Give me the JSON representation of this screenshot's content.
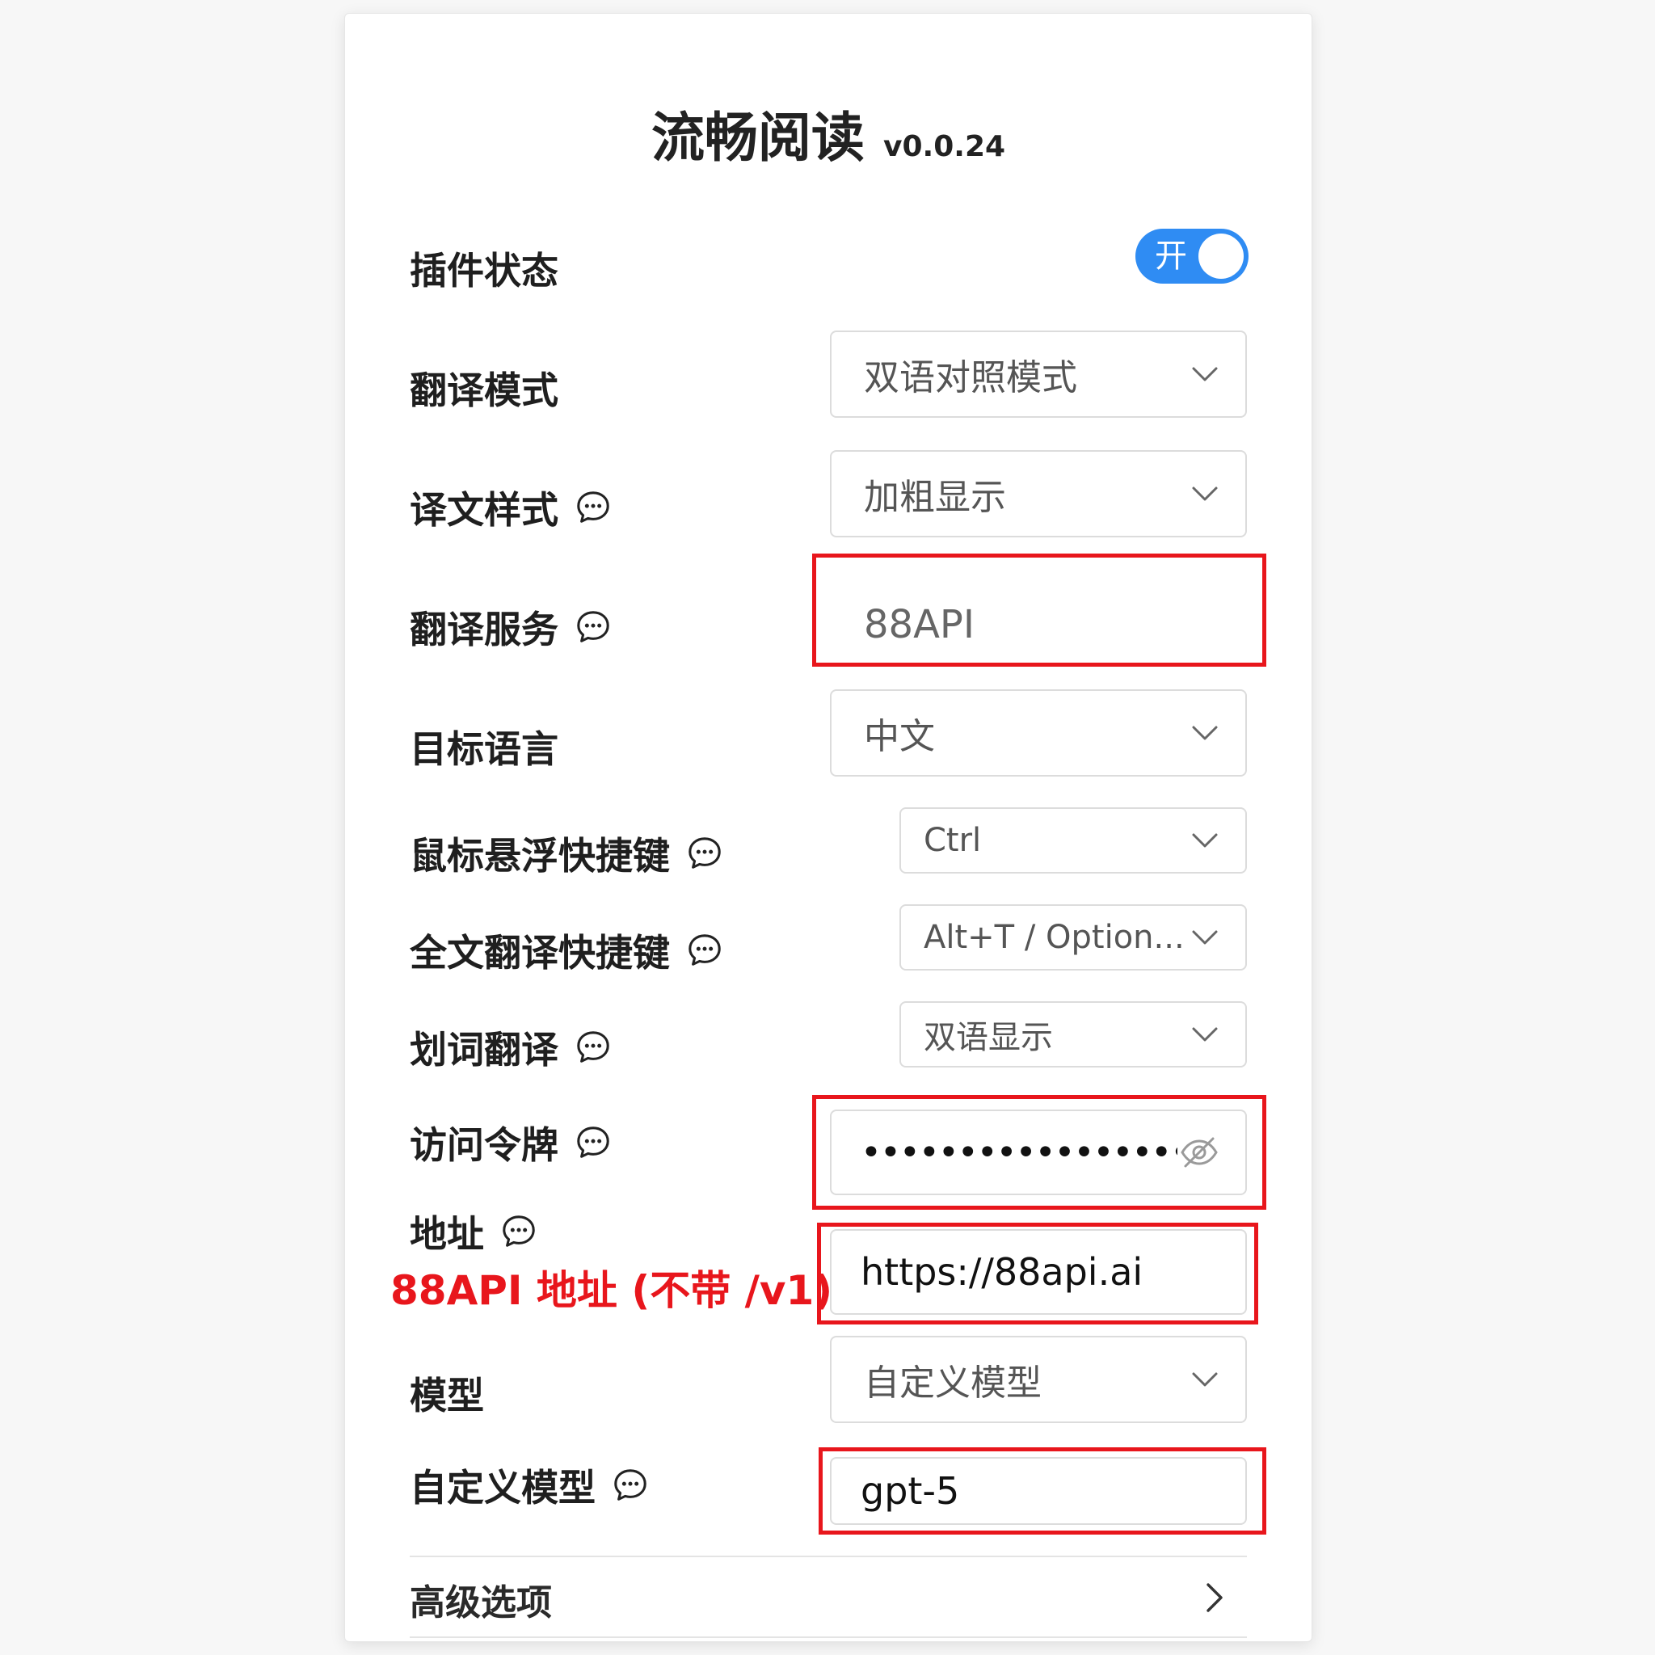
{
  "header": {
    "title": "流畅阅读",
    "version": "v0.0.24"
  },
  "settings": {
    "plugin_status": {
      "label": "插件状态",
      "toggle_text": "开",
      "enabled": true
    },
    "translation_mode": {
      "label": "翻译模式",
      "value": "双语对照模式"
    },
    "translation_style": {
      "label": "译文样式",
      "value": "加粗显示"
    },
    "translation_service": {
      "label": "翻译服务",
      "value": "88API"
    },
    "target_language": {
      "label": "目标语言",
      "value": "中文"
    },
    "hover_hotkey": {
      "label": "鼠标悬浮快捷键",
      "value": "Ctrl"
    },
    "fulltext_hotkey": {
      "label": "全文翻译快捷键",
      "value": "Alt+T / Option..."
    },
    "selection_translate": {
      "label": "划词翻译",
      "value": "双语显示"
    },
    "access_token": {
      "label": "访问令牌",
      "masked_value": "•••••••••••••••••••••"
    },
    "address": {
      "label": "地址",
      "value": "https://88api.ai",
      "annotation": "88API 地址 (不带 /v1)"
    },
    "model": {
      "label": "模型",
      "value": "自定义模型"
    },
    "custom_model": {
      "label": "自定义模型",
      "value": "gpt-5"
    }
  },
  "footer": {
    "advanced_label": "高级选项"
  },
  "colors": {
    "accent": "#2f8cf3",
    "highlight": "#e8161c"
  },
  "icons": {
    "info": "chat-bubble-icon",
    "dropdown": "chevron-down-icon",
    "visibility": "eye-off-icon",
    "advanced": "chevron-right-icon"
  }
}
